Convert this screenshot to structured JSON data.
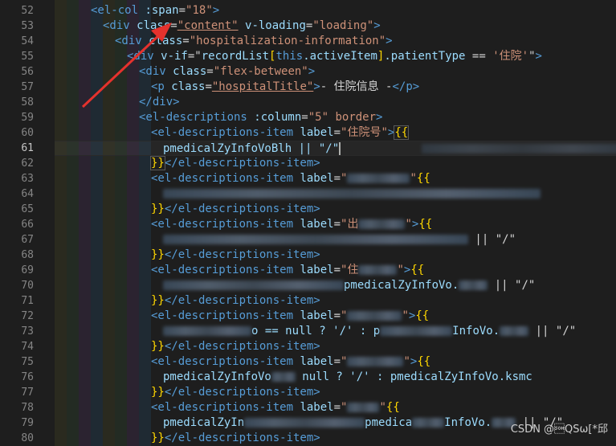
{
  "editor": {
    "active_line": "61",
    "lines": [
      {
        "n": "52"
      },
      {
        "n": "53"
      },
      {
        "n": "54"
      },
      {
        "n": "55"
      },
      {
        "n": "56"
      },
      {
        "n": "57"
      },
      {
        "n": "58"
      },
      {
        "n": "59"
      },
      {
        "n": "60"
      },
      {
        "n": "61"
      },
      {
        "n": "62"
      },
      {
        "n": "63"
      },
      {
        "n": "64"
      },
      {
        "n": "65"
      },
      {
        "n": "66"
      },
      {
        "n": "67"
      },
      {
        "n": "68"
      },
      {
        "n": "69"
      },
      {
        "n": "70"
      },
      {
        "n": "71"
      },
      {
        "n": "72"
      },
      {
        "n": "73"
      },
      {
        "n": "74"
      },
      {
        "n": "75"
      },
      {
        "n": "76"
      },
      {
        "n": "77"
      },
      {
        "n": "78"
      },
      {
        "n": "79"
      },
      {
        "n": "80"
      }
    ],
    "code": {
      "l52_tag": "<el-col",
      "l52_attr": " :span",
      "l52_eq": "=",
      "l52_val": "\"18\"",
      "l52_end": ">",
      "l53_tag": "<div",
      "l53_attr1": " class",
      "l53_val1": "\"content\"",
      "l53_attr2": " v-loading",
      "l53_val2": "\"loading\"",
      "l53_end": ">",
      "l54_tag": "<div",
      "l54_attr": " class",
      "l54_val": "\"hospitalization-information\"",
      "l54_end": ">",
      "l55_tag": "<div",
      "l55_attr": " v-if",
      "l55_q": "=\"",
      "l55_var1": "recordList",
      "l55_b1": "[",
      "l55_kw": "this",
      "l55_var2": ".activeItem",
      "l55_b2": "]",
      "l55_var3": ".patientType",
      "l55_op": " == ",
      "l55_str": "'住院'",
      "l55_endq": "\"",
      "l55_end": ">",
      "l56_tag": "<div",
      "l56_attr": " class",
      "l56_val": "\"flex-between\"",
      "l56_end": ">",
      "l57_tag": "<p",
      "l57_attr": " class",
      "l57_val": "\"hospitalTitle\"",
      "l57_end": ">",
      "l57_text": "- 住院信息 -",
      "l57_close": "</p>",
      "l58_close": "</div>",
      "l59_tag": "<el-descriptions",
      "l59_attr1": " :column",
      "l59_val1": "\"5\"",
      "l59_attr2": " border",
      "l59_end": ">",
      "item_tag": "<el-descriptions-item",
      "item_attr": " label",
      "item_close": "</el-descriptions-item>",
      "l60_label": "\"住院号\"",
      "open_brace": "{{",
      "close_brace": "}}",
      "l61_expr": "pmedicalZyInfoVoBlh || \"/\"",
      "l61_ghost": "            ",
      "l63_label_a": "\"",
      "l63_label_b": "\"",
      "l66_label_a": "\"出",
      "l66_label_b": "\"",
      "l67_tail": " || \"/\"",
      "l69_label_a": "\"住",
      "l69_label_b": "\"",
      "l70_mid": "pmedicalZyInfoVo.",
      "l70_tail": " || \"/\"",
      "l72_label_a": "\"",
      "l72_label_b": "\"",
      "l73_a": "o == null ? '/' : p",
      "l73_tail": "InfoVo.",
      "l73_tail2": " || \"/\"",
      "l75_label_a": "\"",
      "l75_label_b": "\"",
      "l76_a": "pmedicalZyInfoVo",
      "l76_b": " null ? '/' : pmedicalZyInfoVo.ksmc",
      "l78_label_a": "\"",
      "l78_label_b": "\"",
      "l79_a": "pmedicalZyIn",
      "l79_b": "pmedica",
      "l79_c": "InfoVo.",
      "l79_tail": " || \"/\""
    }
  },
  "watermark": "CSDN @\u0001QSω[*邱",
  "colors": {
    "background": "#1e1e1e",
    "tag": "#569cd6",
    "attribute": "#9cdcfe",
    "string": "#ce9178",
    "brace": "#ffd700",
    "arrow": "#e5322d"
  }
}
